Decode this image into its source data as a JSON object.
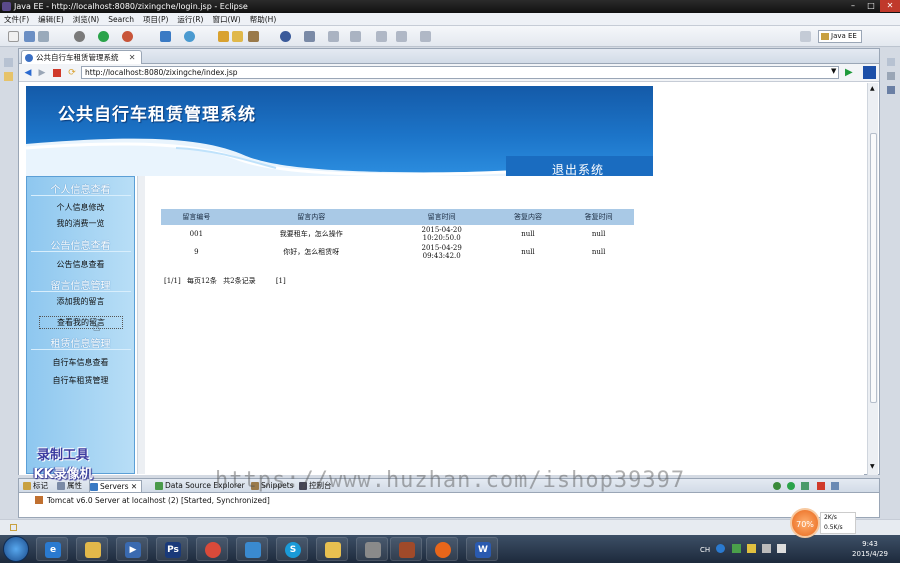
{
  "window": {
    "title": "Java EE - http://localhost:8080/zixingche/login.jsp - Eclipse"
  },
  "menu": [
    "文件(F)",
    "编辑(E)",
    "浏览(N)",
    "Search",
    "项目(P)",
    "运行(R)",
    "窗口(W)",
    "帮助(H)"
  ],
  "toolbar": {
    "perspective": "Java EE"
  },
  "editor": {
    "tab_label": "公共自行车租赁管理系统",
    "url": "http://localhost:8080/zixingche/index.jsp"
  },
  "site": {
    "title": "公共自行车租赁管理系统",
    "logout": "退出系统"
  },
  "sidebar": {
    "sections": [
      {
        "title": "个人信息查看",
        "links": [
          "个人信息修改",
          "我的消费一览"
        ]
      },
      {
        "title": "公告信息查看",
        "links": [
          "公告信息查看"
        ]
      },
      {
        "title": "留言信息管理",
        "links": [
          "添加我的留言",
          "查看我的留言"
        ]
      },
      {
        "title": "租赁信息管理",
        "links": [
          "自行车信息查看",
          "自行车租赁管理"
        ]
      }
    ]
  },
  "table": {
    "headers": [
      "留言编号",
      "留言内容",
      "留言时间",
      "答复内容",
      "答复时间"
    ],
    "rows": [
      [
        "001",
        "我要租车，怎么操作",
        "2015-04-20\n10:20:50.0",
        "null",
        "null"
      ],
      [
        "9",
        "你好，怎么租赁呀",
        "2015-04-29\n09:43:42.0",
        "null",
        "null"
      ]
    ]
  },
  "pager": {
    "page": "[1/1]",
    "per_page": "每页12条",
    "total": "共2条记录",
    "link": "[1]"
  },
  "panel": {
    "tabs": [
      "标记",
      "属性",
      "Servers",
      "Data Source Explorer",
      "Snippets",
      "控制台"
    ],
    "server_status": "Tomcat v6.0 Server at localhost (2)  [Started, Synchronized]"
  },
  "overlay": {
    "recorder_line1": "录制工具",
    "recorder_line2": "KK录像机",
    "watermark": "https://www.huzhan.com/ishop39397",
    "perf": "70%",
    "speed_up": "2K/s",
    "speed_down": "0.5K/s"
  },
  "taskbar": {
    "time": "9:43",
    "date": "2015/4/29",
    "lang": "CH"
  },
  "colors": {
    "banner": "#1c74c8",
    "sidebar": "#8ec7ef",
    "table_header": "#a9c9e6"
  }
}
